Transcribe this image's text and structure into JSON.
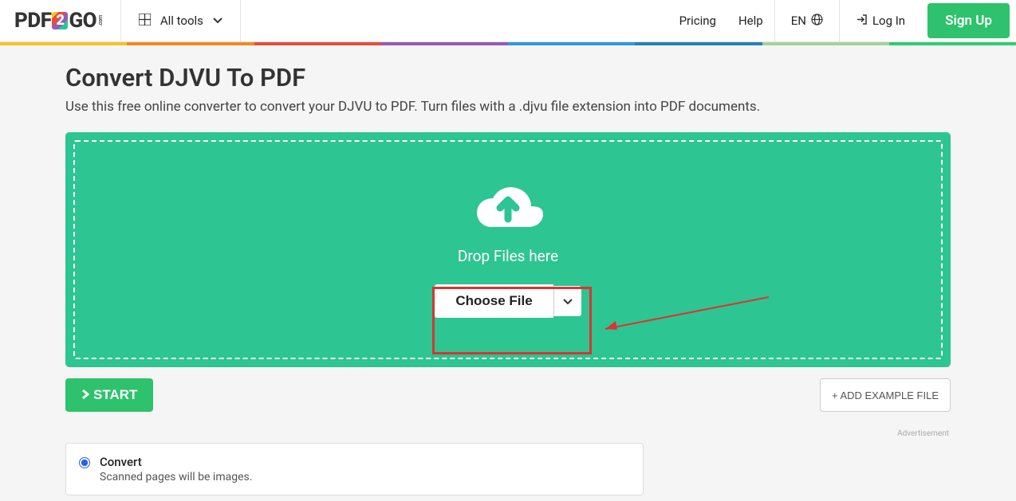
{
  "logo": {
    "prefix": "PDF",
    "suffix": "GO",
    "dot": ".com"
  },
  "nav": {
    "all_tools": "All tools",
    "pricing": "Pricing",
    "help": "Help",
    "lang": "EN",
    "login": "Log In",
    "signup": "Sign Up"
  },
  "page": {
    "title": "Convert DJVU To PDF",
    "subtitle": "Use this free online converter to convert your DJVU to PDF. Turn files with a .djvu file extension into PDF documents."
  },
  "drop": {
    "label": "Drop Files here",
    "choose": "Choose File"
  },
  "actions": {
    "start": "START",
    "example": "+ ADD EXAMPLE FILE"
  },
  "ad_label": "Advertisement",
  "option": {
    "title": "Convert",
    "subtitle": "Scanned pages will be images."
  }
}
